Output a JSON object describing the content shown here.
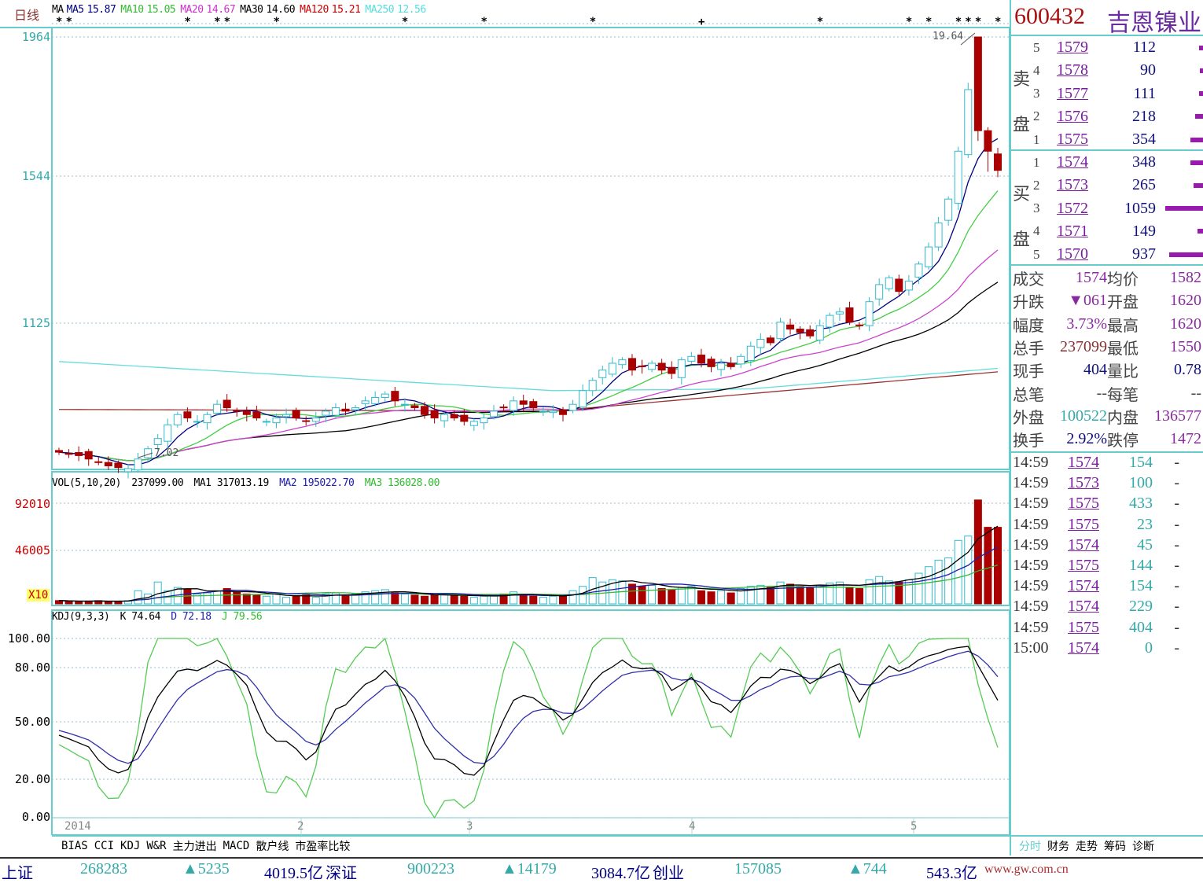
{
  "period_label": "日线",
  "ma_legend": [
    {
      "label": "MA",
      "color": "#000000"
    },
    {
      "label": "MA5",
      "value": "15.87",
      "color": "#000080"
    },
    {
      "label": "MA10",
      "value": "15.05",
      "color": "#33bb33"
    },
    {
      "label": "MA20",
      "value": "14.67",
      "color": "#cc33cc"
    },
    {
      "label": "MA30",
      "value": "14.60",
      "color": "#000000"
    },
    {
      "label": "MA120",
      "value": "15.21",
      "color": "#cc0000"
    },
    {
      "label": "MA250",
      "value": "12.56",
      "color": "#55dddd"
    }
  ],
  "price_axis": [
    "1964",
    "1544",
    "1125"
  ],
  "annotations": {
    "high": "19.64",
    "low": "7.02"
  },
  "vol_legend": {
    "name": "VOL(5,10,20)",
    "vol": "237099.00",
    "ma1": "MA1 317013.19",
    "ma2": "MA2 195022.70",
    "ma3": "MA3 136028.00"
  },
  "vol_axis": [
    "92010",
    "46005"
  ],
  "vol_multiplier": "X10",
  "kdj_legend": {
    "name": "KDJ(9,3,3)",
    "k": "K 74.64",
    "d": "D 72.18",
    "j": "J 79.56"
  },
  "kdj_axis": [
    "100.00",
    "80.00",
    "50.00",
    "20.00",
    "0.00"
  ],
  "date_labels": [
    "2014",
    "2",
    "3",
    "4",
    "5"
  ],
  "indicator_tabs": [
    "BIAS",
    "CCI",
    "KDJ",
    "W&R",
    "主力进出",
    "MACD",
    "散户线",
    "市盈率比较"
  ],
  "right_tabs": [
    "分时",
    "财务",
    "走势",
    "筹码",
    "诊断"
  ],
  "colors": {
    "up": "#33bbcc",
    "down": "#aa0000",
    "grid": "#66cccc"
  },
  "stock": {
    "code": "600432",
    "name": "吉恩镍业"
  },
  "asks_label": "卖盘",
  "bids_label": "买盘",
  "asks": [
    {
      "level": "5",
      "price": "1579",
      "volume": "112",
      "depth": 0.04
    },
    {
      "level": "4",
      "price": "1578",
      "volume": "90",
      "depth": 0.03
    },
    {
      "level": "3",
      "price": "1577",
      "volume": "111",
      "depth": 0.04
    },
    {
      "level": "2",
      "price": "1576",
      "volume": "218",
      "depth": 0.08
    },
    {
      "level": "1",
      "price": "1575",
      "volume": "354",
      "depth": 0.13
    }
  ],
  "bids": [
    {
      "level": "1",
      "price": "1574",
      "volume": "348",
      "depth": 0.13
    },
    {
      "level": "2",
      "price": "1573",
      "volume": "265",
      "depth": 0.1
    },
    {
      "level": "3",
      "price": "1572",
      "volume": "1059",
      "depth": 0.4
    },
    {
      "level": "4",
      "price": "1571",
      "volume": "149",
      "depth": 0.06
    },
    {
      "level": "5",
      "price": "1570",
      "volume": "937",
      "depth": 0.36
    }
  ],
  "stats": [
    {
      "l1": "成交",
      "v1": "1574",
      "l2": "均价",
      "v2": "1582",
      "c1": "#8a2aa0",
      "c2": "#8a2aa0"
    },
    {
      "l1": "升跌",
      "v1": "▼061",
      "l2": "开盘",
      "v2": "1620",
      "c1": "#8a2aa0",
      "c2": "#8a2aa0"
    },
    {
      "l1": "幅度",
      "v1": "3.73%",
      "l2": "最高",
      "v2": "1620",
      "c1": "#8a2aa0",
      "c2": "#8a2aa0"
    },
    {
      "l1": "总手",
      "v1": "237099",
      "l2": "最低",
      "v2": "1550",
      "c1": "#8a3030",
      "c2": "#8a2aa0"
    },
    {
      "l1": "现手",
      "v1": "404",
      "l2": "量比",
      "v2": "0.78",
      "c1": "#101080",
      "c2": "#101080"
    },
    {
      "l1": "总笔",
      "v1": "--",
      "l2": "每笔",
      "v2": "--",
      "c1": "#444",
      "c2": "#444"
    },
    {
      "l1": "外盘",
      "v1": "100522",
      "l2": "内盘",
      "v2": "136577",
      "c1": "#33aaaa",
      "c2": "#8a2aa0"
    },
    {
      "l1": "换手",
      "v1": "2.92%",
      "l2": "跌停",
      "v2": "1472",
      "c1": "#101080",
      "c2": "#8a2aa0"
    }
  ],
  "ticks": [
    {
      "time": "14:59",
      "price": "1574",
      "volume": "154",
      "dir": "-"
    },
    {
      "time": "14:59",
      "price": "1573",
      "volume": "100",
      "dir": "-"
    },
    {
      "time": "14:59",
      "price": "1575",
      "volume": "433",
      "dir": "-"
    },
    {
      "time": "14:59",
      "price": "1575",
      "volume": "23",
      "dir": "-"
    },
    {
      "time": "14:59",
      "price": "1574",
      "volume": "45",
      "dir": "-"
    },
    {
      "time": "14:59",
      "price": "1575",
      "volume": "144",
      "dir": "-"
    },
    {
      "time": "14:59",
      "price": "1574",
      "volume": "154",
      "dir": "-"
    },
    {
      "time": "14:59",
      "price": "1574",
      "volume": "229",
      "dir": "-"
    },
    {
      "time": "14:59",
      "price": "1575",
      "volume": "404",
      "dir": "-"
    },
    {
      "time": "15:00",
      "price": "1574",
      "volume": "0",
      "dir": "-"
    }
  ],
  "status_bar": {
    "sh_label": "上证",
    "sh_vol": "268283",
    "sh_chg": "▲5235",
    "sh_amt": "4019.5亿",
    "sz_label": "深证",
    "sz_vol": "900223",
    "sz_chg": "▲14179",
    "sz_amt": "3084.7亿",
    "cy_label": "创业",
    "cy_vol": "157085",
    "cy_chg": "▲744",
    "cy_amt": "543.3亿",
    "site": "www.gw.com.cn"
  },
  "chart_data": {
    "type": "candlestick",
    "close": [
      7.5,
      7.45,
      7.4,
      7.3,
      7.2,
      7.1,
      7.05,
      7.02,
      7.3,
      7.6,
      7.9,
      8.3,
      8.6,
      8.5,
      8.4,
      8.6,
      8.9,
      8.8,
      8.7,
      8.6,
      8.5,
      8.4,
      8.5,
      8.6,
      8.5,
      8.4,
      8.5,
      8.7,
      8.8,
      8.7,
      8.8,
      9.0,
      9.1,
      9.2,
      9.0,
      8.9,
      8.8,
      8.6,
      8.5,
      8.6,
      8.5,
      8.4,
      8.4,
      8.5,
      8.7,
      8.8,
      9.0,
      8.9,
      8.8,
      8.7,
      8.7,
      8.6,
      8.9,
      9.3,
      9.6,
      9.9,
      10.1,
      10.2,
      9.9,
      10.0,
      10.1,
      9.9,
      9.8,
      10.2,
      10.3,
      10.1,
      10.0,
      10.1,
      10.0,
      10.3,
      10.6,
      10.8,
      10.7,
      11.3,
      11.1,
      11.0,
      10.9,
      11.2,
      11.5,
      11.6,
      11.3,
      11.2,
      11.9,
      12.4,
      12.6,
      12.2,
      12.5,
      13.0,
      13.5,
      14.2,
      14.9,
      16.3,
      18.1,
      16.9,
      16.3,
      15.74
    ],
    "ohlc_overrides": {
      "93": [
        19.64,
        19.64,
        16.6,
        16.9
      ],
      "92": [
        16.2,
        18.3,
        16.1,
        18.1
      ],
      "94": [
        16.9,
        17.0,
        15.7,
        16.3
      ]
    },
    "volume": [
      3000,
      2500,
      2000,
      2500,
      3000,
      2000,
      2500,
      3000,
      12000,
      9000,
      20000,
      12000,
      15000,
      13000,
      9000,
      10000,
      12000,
      14000,
      11000,
      9000,
      8000,
      7000,
      9000,
      6000,
      7000,
      8000,
      6000,
      9000,
      10000,
      8000,
      9000,
      11000,
      12000,
      13000,
      10000,
      9000,
      8000,
      7000,
      8000,
      9000,
      8000,
      7000,
      6000,
      7000,
      8000,
      9000,
      11000,
      8000,
      7000,
      6000,
      7000,
      8000,
      12000,
      16000,
      24000,
      20000,
      22000,
      21000,
      18000,
      16000,
      17000,
      14000,
      13000,
      15000,
      16000,
      12000,
      11000,
      12000,
      10000,
      14000,
      16000,
      17000,
      15000,
      20000,
      18000,
      16000,
      15000,
      17000,
      19000,
      20000,
      15000,
      14000,
      22000,
      25000,
      21000,
      20000,
      22000,
      28000,
      34000,
      40000,
      42000,
      58000,
      62000,
      95000,
      70000,
      70000
    ],
    "ma120": [
      [
        0,
        8.75
      ],
      [
        50,
        8.7
      ],
      [
        95,
        9.85
      ]
    ],
    "ma250": [
      [
        0,
        10.15
      ],
      [
        50,
        9.3
      ],
      [
        70,
        9.35
      ],
      [
        95,
        9.95
      ]
    ],
    "price_range": [
      7.0,
      19.64
    ],
    "vol_max": 92010,
    "kdj_range": [
      0,
      100
    ],
    "signal_markers": [
      {
        "i": 0,
        "s": "*"
      },
      {
        "i": 1,
        "s": "*"
      },
      {
        "i": 13,
        "s": "*"
      },
      {
        "i": 16,
        "s": "*"
      },
      {
        "i": 17,
        "s": "*"
      },
      {
        "i": 22,
        "s": "*"
      },
      {
        "i": 35,
        "s": "*"
      },
      {
        "i": 43,
        "s": "*"
      },
      {
        "i": 54,
        "s": "*"
      },
      {
        "i": 65,
        "s": "+"
      },
      {
        "i": 77,
        "s": "*"
      },
      {
        "i": 86,
        "s": "*"
      },
      {
        "i": 88,
        "s": "*"
      },
      {
        "i": 91,
        "s": "*"
      },
      {
        "i": 92,
        "s": "*"
      },
      {
        "i": 93,
        "s": "*"
      },
      {
        "i": 95,
        "s": "*"
      }
    ]
  }
}
